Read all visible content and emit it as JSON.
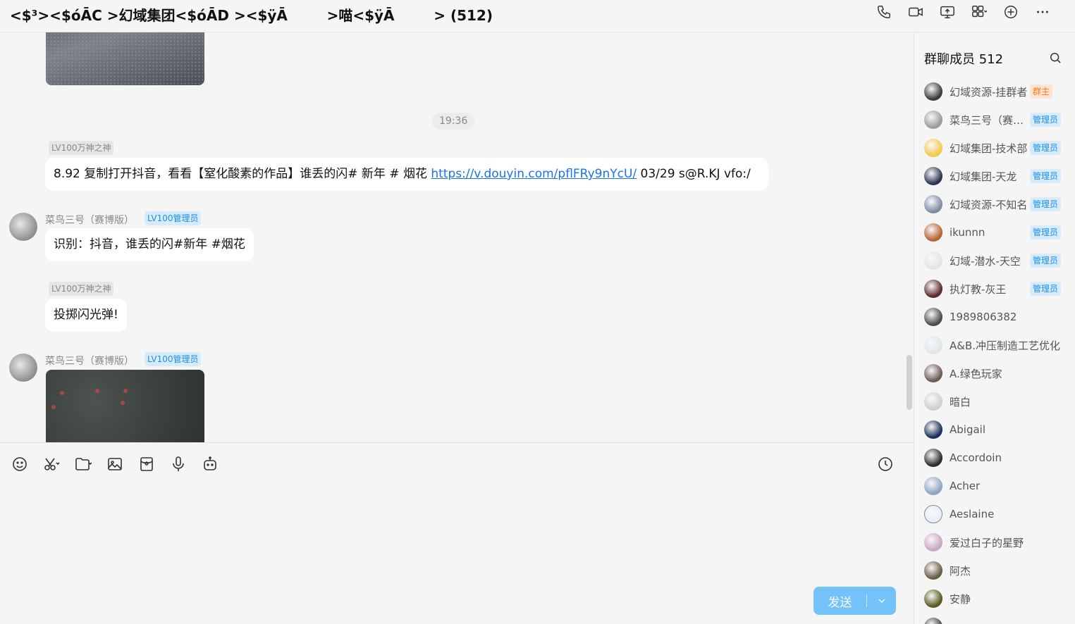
{
  "header": {
    "title": "<$³><$óĀC >幻域集团<$óĀD ><$ÿĀ        >喵<$ÿĀ        > (512)",
    "icons": [
      "phone-icon",
      "video-call-icon",
      "screen-share-icon",
      "apps-icon",
      "add-icon",
      "more-icon"
    ]
  },
  "chat": {
    "time_divider": "19:36",
    "messages": [
      {
        "level_badge": "LV100万神之神",
        "text_before_link": "8.92 复制打开抖音，看看【窒化酸素的作品】谁丢的闪# 新年 # 烟花  ",
        "link": "https://v.douyin.com/pflFRy9nYcU/",
        "text_after_link": " 03/29 s@R.KJ vfo:/"
      },
      {
        "sender": "菜鸟三号（赛博版）",
        "role_badge": "LV100管理员",
        "text": "识别：抖音，谁丢的闪#新年 #烟花"
      },
      {
        "level_badge": "LV100万神之神",
        "text": "投掷闪光弹!"
      },
      {
        "sender": "菜鸟三号（赛博版）",
        "role_badge": "LV100管理员"
      }
    ]
  },
  "composer": {
    "tools": [
      "emoji-icon",
      "screenshot-icon",
      "folder-icon",
      "image-icon",
      "red-packet-icon",
      "voice-icon",
      "bot-icon"
    ],
    "send_label": "发送"
  },
  "sidebar": {
    "title": "群聊成员 512",
    "members": [
      {
        "name": "幻域资源-挂群者",
        "badge": "群主",
        "badge_type": "owner",
        "color": "#3a3a3a"
      },
      {
        "name": "菜鸟三号（赛博版）",
        "badge": "管理员",
        "badge_type": "admin",
        "color": "#9a9a9a"
      },
      {
        "name": "幻域集团-技术部",
        "badge": "管理员",
        "badge_type": "admin",
        "color": "#f2c94c"
      },
      {
        "name": "幻域集团-天龙",
        "badge": "管理员",
        "badge_type": "admin",
        "color": "#27344f"
      },
      {
        "name": "幻域资源-不知名",
        "badge": "管理员",
        "badge_type": "admin",
        "color": "#7d8ba3"
      },
      {
        "name": "ikunnn",
        "badge": "管理员",
        "badge_type": "admin",
        "color": "#b8632f"
      },
      {
        "name": "幻域-潜水-天空",
        "badge": "管理员",
        "badge_type": "admin",
        "color": "#e4e4e4"
      },
      {
        "name": "执灯教-灰王",
        "badge": "管理员",
        "badge_type": "admin",
        "color": "#5b2a2a"
      },
      {
        "name": "1989806382",
        "badge": "",
        "badge_type": "",
        "color": "#4b4b4b"
      },
      {
        "name": "A&B.冲压制造工艺优化",
        "badge": "",
        "badge_type": "",
        "color": "#dfe6ea"
      },
      {
        "name": "A.绿色玩家",
        "badge": "",
        "badge_type": "",
        "color": "#6d5a55"
      },
      {
        "name": "暗白",
        "badge": "",
        "badge_type": "",
        "color": "#cfcfcf"
      },
      {
        "name": "Abigail",
        "badge": "",
        "badge_type": "",
        "color": "#1c2f5a"
      },
      {
        "name": "Accordoin",
        "badge": "",
        "badge_type": "",
        "color": "#2b2b2b"
      },
      {
        "name": "Acher",
        "badge": "",
        "badge_type": "",
        "color": "#8ea4bf"
      },
      {
        "name": "Aeslaine",
        "badge": "",
        "badge_type": "",
        "color": "#e9eef7"
      },
      {
        "name": "爱过白子的星野",
        "badge": "",
        "badge_type": "",
        "color": "#c9a6c4"
      },
      {
        "name": "阿杰",
        "badge": "",
        "badge_type": "",
        "color": "#6b5a44"
      },
      {
        "name": "安静",
        "badge": "",
        "badge_type": "",
        "color": "#5a5a1e"
      },
      {
        "name": "",
        "badge": "",
        "badge_type": "",
        "color": "#444444"
      }
    ]
  }
}
